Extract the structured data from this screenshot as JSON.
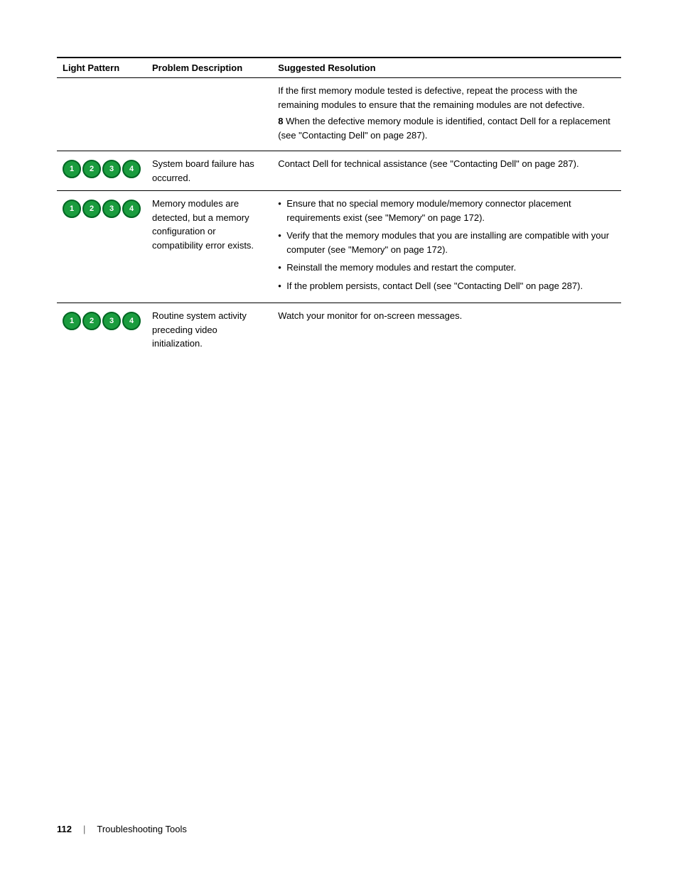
{
  "page": {
    "number": "112",
    "section_title": "Troubleshooting Tools"
  },
  "table": {
    "headers": {
      "col1": "Light Pattern",
      "col2": "Problem Description",
      "col3": "Suggested Resolution"
    },
    "rows": [
      {
        "id": "row-top",
        "light_pattern": null,
        "circles": null,
        "problem": "",
        "resolution_parts": [
          {
            "type": "text",
            "text": "If the first memory module tested is defective, repeat the process with the remaining modules to ensure that the remaining modules are not defective."
          },
          {
            "type": "numbered",
            "number": "8",
            "text": "When the defective memory module is identified, contact Dell for a replacement (see \"Contacting Dell\" on page 287)."
          }
        ]
      },
      {
        "id": "row-1234-board",
        "circles": [
          "1",
          "2",
          "3",
          "4"
        ],
        "circle_style": "all_green",
        "problem": "System board failure has occurred.",
        "resolution_parts": [
          {
            "type": "text",
            "text": "Contact Dell for technical assistance (see \"Contacting Dell\" on page 287)."
          }
        ]
      },
      {
        "id": "row-1234-memory",
        "circles": [
          "1",
          "2",
          "3",
          "4"
        ],
        "circle_style": "all_green",
        "problem": "Memory modules are detected, but a memory configuration or compatibility error exists.",
        "resolution_parts": [
          {
            "type": "bullet",
            "text": "Ensure that no special memory module/memory connector placement requirements exist (see \"Memory\" on page 172)."
          },
          {
            "type": "bullet",
            "text": "Verify that the memory modules that you are installing are compatible with your computer (see \"Memory\" on page 172)."
          },
          {
            "type": "bullet",
            "text": "Reinstall the memory modules and restart the computer."
          },
          {
            "type": "bullet",
            "text": "If the problem persists, contact Dell (see \"Contacting Dell\" on page 287)."
          }
        ]
      },
      {
        "id": "row-1234-video",
        "circles": [
          "1",
          "2",
          "3",
          "4"
        ],
        "circle_style": "all_green",
        "problem": "Routine system activity preceding video initialization.",
        "resolution_parts": [
          {
            "type": "text",
            "text": "Watch your monitor for on-screen messages."
          }
        ]
      }
    ]
  }
}
